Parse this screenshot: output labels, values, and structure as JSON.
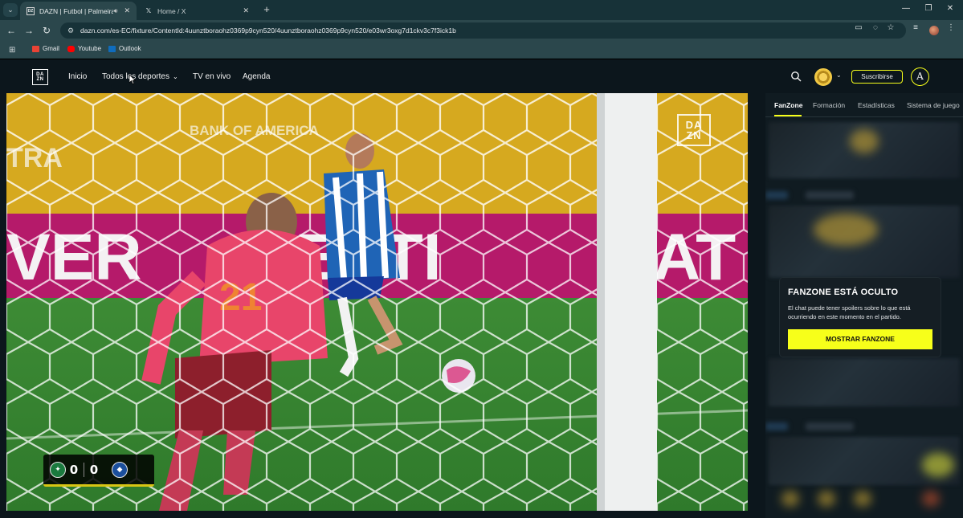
{
  "browser": {
    "tabs": [
      {
        "title": "DAZN | Futbol | Palmeiras v",
        "active": true,
        "audio": true
      },
      {
        "title": "Home / X",
        "active": false
      }
    ],
    "url": "dazn.com/es-EC/fixture/ContentId:4uunztboraohz0369p9cyn520/4uunztboraohz0369p9cyn520/e03wr3oxg7d1ckv3c7f3ick1b",
    "bookmarks": [
      {
        "label": "Gmail",
        "color": "#ea4335"
      },
      {
        "label": "Youtube",
        "color": "#ff0000"
      },
      {
        "label": "Outlook",
        "color": "#0f6cbd"
      }
    ]
  },
  "dazn": {
    "logo": {
      "line1": "DA",
      "line2": "ZN"
    },
    "nav": {
      "inicio": "Inicio",
      "todos": "Todos los deportes",
      "tv": "TV en vivo",
      "agenda": "Agenda"
    },
    "subscribe_label": "Suscribirse",
    "user_initial": "A",
    "accent": "#f7ff1a"
  },
  "video": {
    "watermark": {
      "line1": "DA",
      "line2": "ZN"
    },
    "scoreboard": {
      "home_score": "0",
      "away_score": "0"
    }
  },
  "side_panel": {
    "tabs": [
      "FanZone",
      "Formación",
      "Estadísticas",
      "Sistema de juego"
    ],
    "fanzone": {
      "title": "FANZONE ESTÁ OCULTO",
      "text": "El chat puede tener spoilers sobre lo que está ocurriendo en este momento en el partido.",
      "button_label": "MOSTRAR FANZONE"
    }
  }
}
